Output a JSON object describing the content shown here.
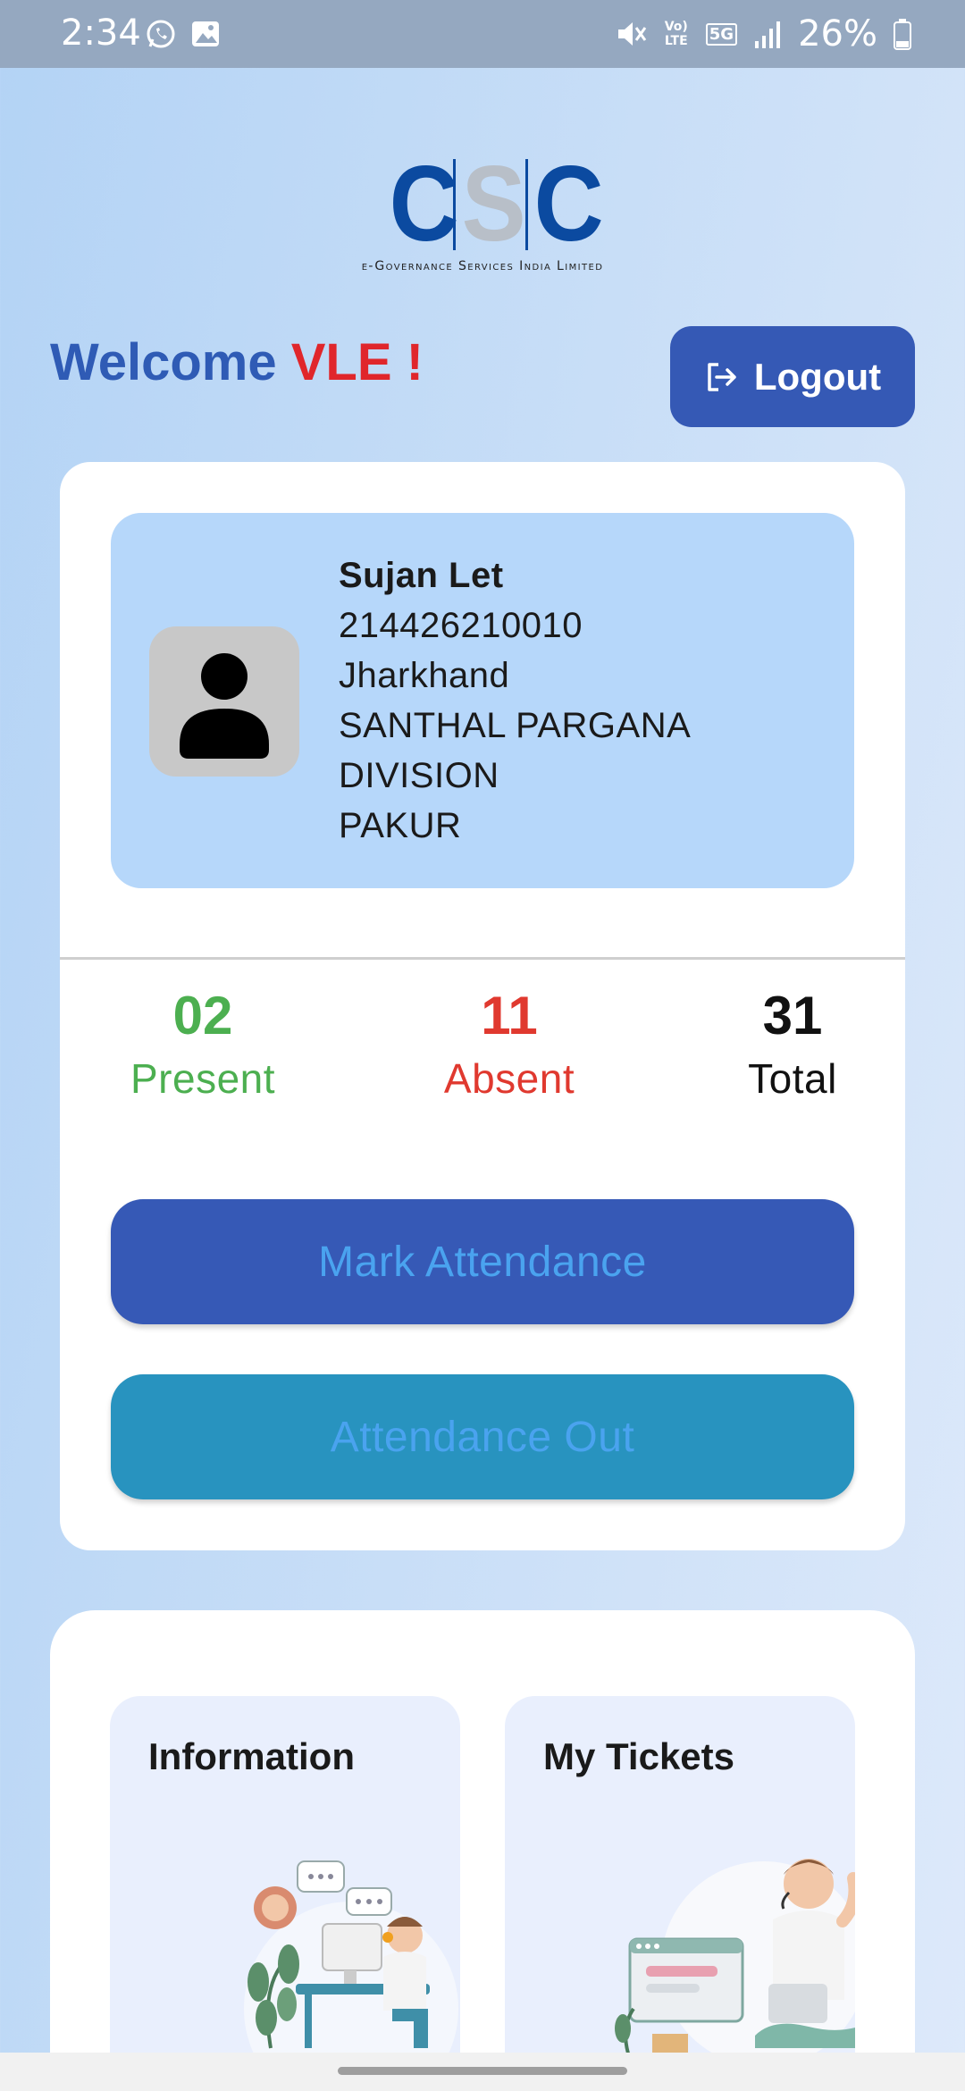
{
  "status_bar": {
    "time": "2:34",
    "battery": "26%",
    "icons": [
      "whatsapp-icon",
      "gallery-icon",
      "mute-icon",
      "volte-icon",
      "5g-icon",
      "signal-icon",
      "battery-icon"
    ],
    "network_volte": "Vo) LTE",
    "network_5g": "5G"
  },
  "logo": {
    "letters": [
      "C",
      "S",
      "C"
    ],
    "subtitle": "e-Governance Services India Limited"
  },
  "header": {
    "welcome_text": "Welcome ",
    "welcome_name": "VLE !",
    "logout_label": "Logout",
    "logout_icon": "logout-icon"
  },
  "profile": {
    "avatar_icon": "person-icon",
    "name": "Sujan Let",
    "id": "214426210010",
    "state": "Jharkhand",
    "division_line1": "SANTHAL PARGANA",
    "division_line2": "DIVISION",
    "district": "PAKUR"
  },
  "stats": {
    "present": {
      "value": "02",
      "label": "Present",
      "color": "#4caf50"
    },
    "absent": {
      "value": "11",
      "label": "Absent",
      "color": "#e0392f"
    },
    "total": {
      "value": "31",
      "label": "Total",
      "color": "#111111"
    }
  },
  "actions": {
    "mark_attendance": "Mark Attendance",
    "attendance_out": "Attendance Out"
  },
  "tiles": {
    "information": "Information",
    "my_tickets": "My Tickets"
  },
  "colors": {
    "accent_blue": "#3559b5",
    "teal": "#2893bf",
    "brand_red": "#e0262b"
  }
}
